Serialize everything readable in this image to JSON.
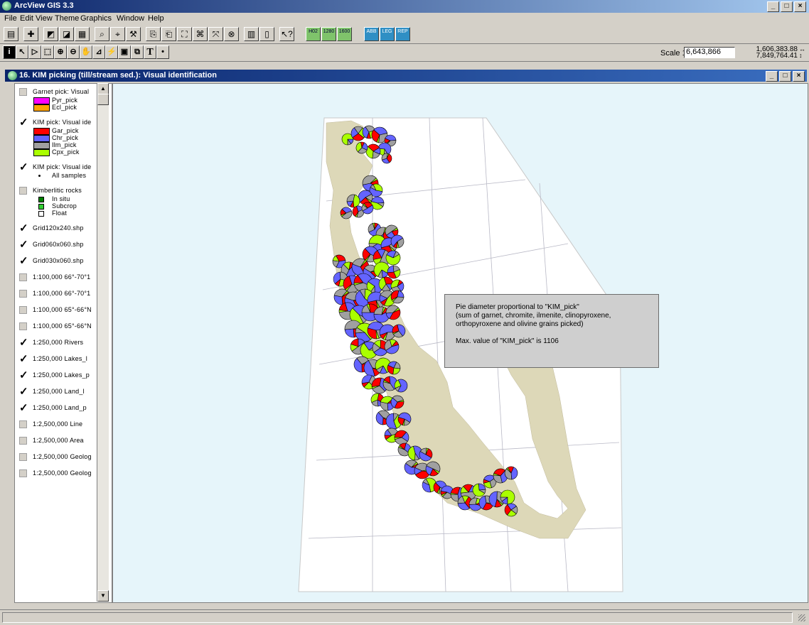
{
  "app": {
    "title": "ArcView GIS 3.3"
  },
  "menu": [
    "File",
    "Edit",
    "View",
    "Theme",
    "Graphics",
    "Window",
    "Help"
  ],
  "toolbar_buttons": [
    "save-icon",
    "add-theme-icon",
    "theme-properties-icon",
    "edit-legend-icon",
    "open-table-icon",
    "find-icon",
    "locate-icon",
    "hot-link-icon",
    "query-builder-icon",
    "select-icon",
    "zoom-full-icon",
    "zoom-active-icon",
    "zoom-selected-icon",
    "zoom-previous-icon",
    "layout-icon",
    "help-icon"
  ],
  "custom_buttons": [
    "H02",
    "1280",
    "1600",
    "ABB",
    "LEG",
    "REP"
  ],
  "tools": [
    "i",
    "↖",
    "▷",
    "⬚",
    "⊕",
    "⊖",
    "✋",
    "⊿",
    "⚡",
    "▣",
    "⧉",
    "T",
    "•"
  ],
  "scale": {
    "label": "Scale 1:",
    "value": "6,643,866"
  },
  "coords": {
    "x": "1,606,383.88",
    "y": "7,849,764.41"
  },
  "view": {
    "title": "16. KIM picking (till/stream sed.): Visual identification"
  },
  "toc": {
    "layers": [
      {
        "name": "Garnet pick: Visual",
        "checked": false,
        "items": [
          {
            "label": "Pyr_pick",
            "color": "#ff00ff"
          },
          {
            "label": "Ecl_pick",
            "color": "#ffa500"
          }
        ]
      },
      {
        "name": "KIM pick: Visual ide",
        "checked": true,
        "items": [
          {
            "label": "Gar_pick",
            "color": "#ff0000"
          },
          {
            "label": "Chr_pick",
            "color": "#6464ff"
          },
          {
            "label": "Ilm_pick",
            "color": "#a0a0a0"
          },
          {
            "label": "Cpx_pick",
            "color": "#aaff00"
          }
        ]
      },
      {
        "name": "KIM pick: Visual ide",
        "checked": true,
        "items": [
          {
            "label": "All samples",
            "color": "dot"
          }
        ]
      },
      {
        "name": "Kimberlitic rocks",
        "checked": false,
        "items": [
          {
            "label": "In situ",
            "color": "#008000"
          },
          {
            "label": "Subcrop",
            "color": "#32cd32"
          },
          {
            "label": "Float",
            "color": "#ffffff"
          }
        ]
      },
      {
        "name": "Grid120x240.shp",
        "checked": true,
        "items": []
      },
      {
        "name": "Grid060x060.shp",
        "checked": true,
        "items": []
      },
      {
        "name": "Grid030x060.shp",
        "checked": true,
        "items": []
      },
      {
        "name": "1:100,000 66°-70°1",
        "checked": false,
        "items": []
      },
      {
        "name": "1:100,000 66°-70°1",
        "checked": false,
        "items": []
      },
      {
        "name": "1:100,000 65°-66°N",
        "checked": false,
        "items": []
      },
      {
        "name": "1:100,000 65°-66°N",
        "checked": false,
        "items": []
      },
      {
        "name": "1:250,000 Rivers",
        "checked": true,
        "items": []
      },
      {
        "name": "1:250,000 Lakes_l",
        "checked": true,
        "items": []
      },
      {
        "name": "1:250,000 Lakes_p",
        "checked": true,
        "items": []
      },
      {
        "name": "1:250,000 Land_l",
        "checked": true,
        "items": []
      },
      {
        "name": "1:250,000 Land_p",
        "checked": true,
        "items": []
      },
      {
        "name": "1:2,500,000 Line",
        "checked": false,
        "items": []
      },
      {
        "name": "1:2,500,000 Area",
        "checked": false,
        "items": []
      },
      {
        "name": "1:2,500,000 Geolog",
        "checked": false,
        "items": []
      },
      {
        "name": "1:2,500,000 Geolog",
        "checked": false,
        "items": []
      }
    ]
  },
  "map": {
    "info_lines": [
      "Pie diameter proportional to \"KIM_pick\"",
      "(sum of garnet, chromite, ilmenite, clinopyroxene,",
      "orthopyroxene and olivine grains picked)",
      "",
      "Max. value of \"KIM_pick\" is 1106"
    ],
    "colors": {
      "gar": "#ff0000",
      "chr": "#6464ff",
      "ilm": "#a0a0a0",
      "cpx": "#aaff00",
      "land": "#ddd8b8",
      "sea": "#e6f5fa"
    }
  }
}
